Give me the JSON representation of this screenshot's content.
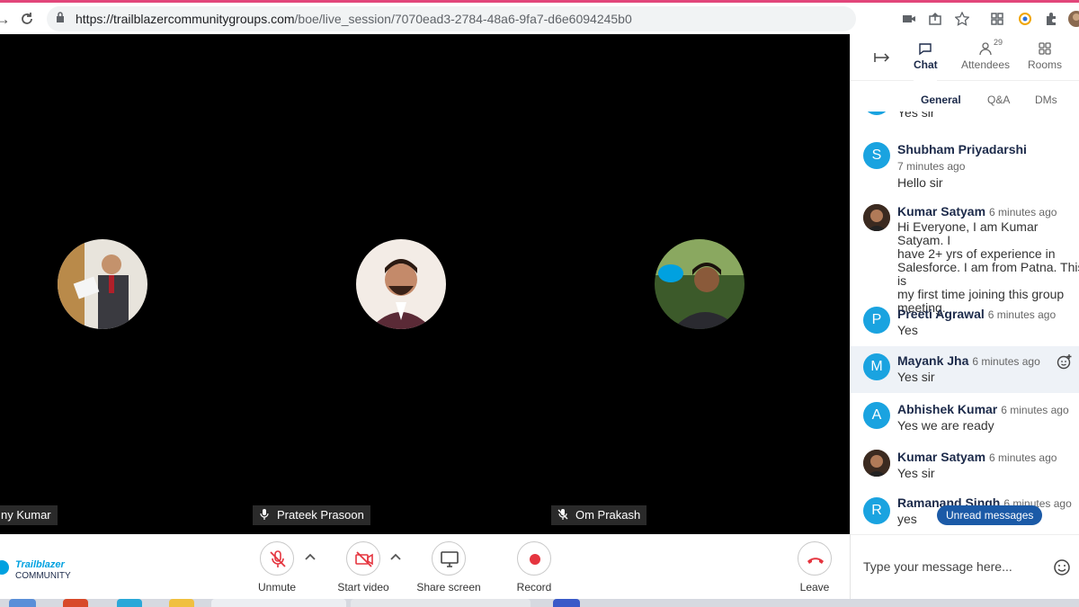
{
  "browser": {
    "url_host": "https://trailblazercommunitygroups.com",
    "url_path": "/boe/live_session/7070ead3-2784-48a6-9fa7-d6e6094245b0"
  },
  "participants": [
    {
      "name": "ny Kumar",
      "mic": "none"
    },
    {
      "name": "Prateek Prasoon",
      "mic": "on"
    },
    {
      "name": "Om Prakash",
      "mic": "muted"
    }
  ],
  "controls": {
    "logo_line1": "Trailblazer",
    "logo_line2": "COMMUNITY",
    "unmute": "Unmute",
    "start_video": "Start video",
    "share_screen": "Share screen",
    "record": "Record",
    "leave": "Leave"
  },
  "sidebar": {
    "tabs": {
      "chat": "Chat",
      "attendees": "Attendees",
      "attendee_count": "29",
      "rooms": "Rooms"
    },
    "subtabs": {
      "general": "General",
      "qa": "Q&A",
      "dms": "DMs"
    },
    "partial_text": "Yes sir",
    "messages": [
      {
        "initial": "S",
        "color": "#1aa3e0",
        "name": "Shubham Priyadarshi",
        "time": "7 minutes ago",
        "text": "Hello sir"
      },
      {
        "initial": "",
        "color": "#5a3b2a",
        "name": "Kumar Satyam",
        "time": "6 minutes ago",
        "text": "Hi Everyone, I am Kumar Satyam. I\nhave 2+ yrs of experience in\nSalesforce. I am from Patna. This is\nmy first time joining this group\nmeeting."
      },
      {
        "initial": "P",
        "color": "#1aa3e0",
        "name": "Preeti Agrawal",
        "time": "6 minutes ago",
        "text": "Yes"
      },
      {
        "initial": "M",
        "color": "#1aa3e0",
        "name": "Mayank Jha",
        "time": "6 minutes ago",
        "text": "Yes sir"
      },
      {
        "initial": "A",
        "color": "#1aa3e0",
        "name": "Abhishek Kumar",
        "time": "6 minutes ago",
        "text": "Yes we are ready"
      },
      {
        "initial": "",
        "color": "#5a3b2a",
        "name": "Kumar Satyam",
        "time": "6 minutes ago",
        "text": "Yes sir"
      },
      {
        "initial": "R",
        "color": "#1aa3e0",
        "name": "Ramanand Singh",
        "time": "6 minutes ago",
        "text": "yes"
      }
    ],
    "unread": "Unread messages",
    "placeholder": "Type your message here..."
  },
  "colors": {
    "accent": "#1b5aa7",
    "record": "#e5353f",
    "brand": "#00a1e0"
  }
}
